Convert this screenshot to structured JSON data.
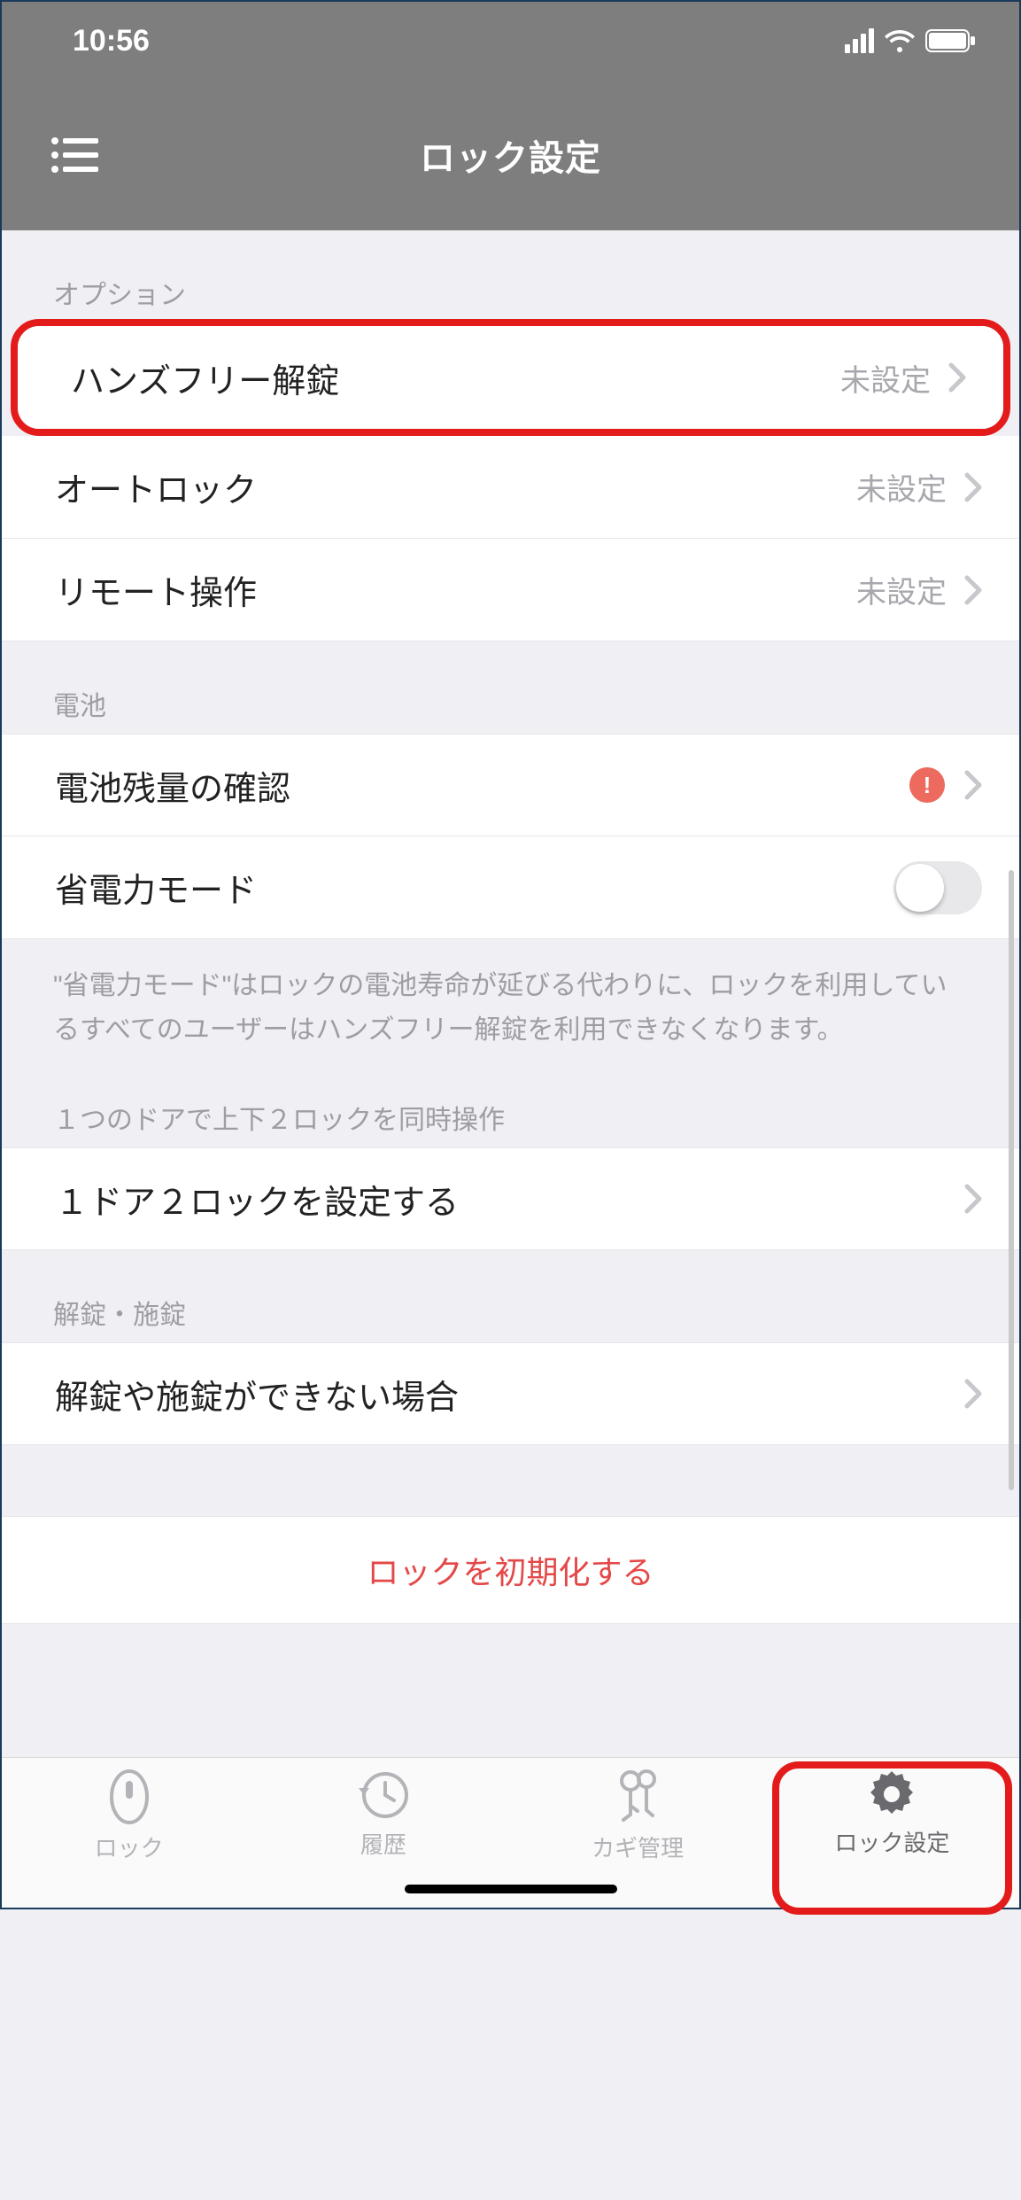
{
  "status": {
    "time": "10:56"
  },
  "header": {
    "title": "ロック設定"
  },
  "sections": {
    "options": {
      "label": "オプション",
      "items": [
        {
          "label": "ハンズフリー解錠",
          "value": "未設定"
        },
        {
          "label": "オートロック",
          "value": "未設定"
        },
        {
          "label": "リモート操作",
          "value": "未設定"
        }
      ]
    },
    "battery": {
      "label": "電池",
      "check": {
        "label": "電池残量の確認",
        "alert": "!"
      },
      "eco": {
        "label": "省電力モード",
        "on": false
      },
      "note": "\"省電力モード\"はロックの電池寿命が延びる代わりに、ロックを利用しているすべてのユーザーはハンズフリー解錠を利用できなくなります。"
    },
    "dual": {
      "label": "１つのドアで上下２ロックを同時操作",
      "item": {
        "label": "１ドア２ロックを設定する"
      }
    },
    "operate": {
      "label": "解錠・施錠",
      "item": {
        "label": "解錠や施錠ができない場合"
      }
    },
    "reset": {
      "label": "ロックを初期化する"
    }
  },
  "tabs": [
    {
      "label": "ロック"
    },
    {
      "label": "履歴"
    },
    {
      "label": "カギ管理"
    },
    {
      "label": "ロック設定"
    }
  ]
}
